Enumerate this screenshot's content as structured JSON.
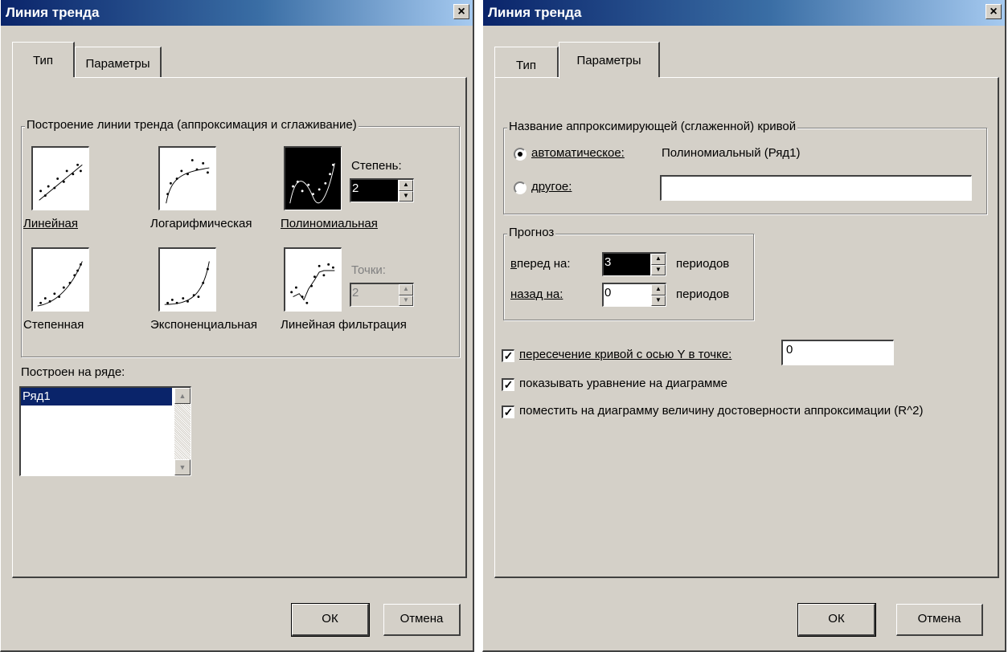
{
  "left": {
    "title": "Линия тренда",
    "close": "×",
    "tabs": [
      "Тип",
      "Параметры"
    ],
    "group_title": "Построение линии тренда (аппроксимация и сглаживание)",
    "types": {
      "linear": "Линейная",
      "logarithmic": "Логарифмическая",
      "polynomial": "Полиномиальная",
      "power": "Степенная",
      "exponential": "Экспоненциальная",
      "moving_average": "Линейная фильтрация"
    },
    "selected_type": "polynomial",
    "degree_label": "Степень:",
    "degree_value": "2",
    "points_label": "Точки:",
    "points_value": "2",
    "series_label": "Построен на ряде:",
    "series_items": [
      "Ряд1"
    ],
    "ok": "ОК",
    "cancel": "Отмена"
  },
  "right": {
    "title": "Линия тренда",
    "close": "×",
    "tabs": [
      "Тип",
      "Параметры"
    ],
    "name_group_title": "Название аппроксимирующей (сглаженной) кривой",
    "auto_label": "автоматическое:",
    "auto_value": "Полиномиальный (Ряд1)",
    "custom_label": "другое:",
    "custom_value": "",
    "forecast_title": "Прогноз",
    "forward_label": "вперед на:",
    "forward_value": "3",
    "backward_label": "назад на:",
    "backward_value": "0",
    "periods_label": "периодов",
    "intercept_label": "пересечение кривой с осью Y в точке:",
    "intercept_value": "0",
    "show_equation_label": "показывать уравнение на диаграмме",
    "show_r2_label": "поместить на диаграмму величину достоверности аппроксимации (R^2)",
    "check_mark": "✓",
    "ok": "ОК",
    "cancel": "Отмена"
  }
}
